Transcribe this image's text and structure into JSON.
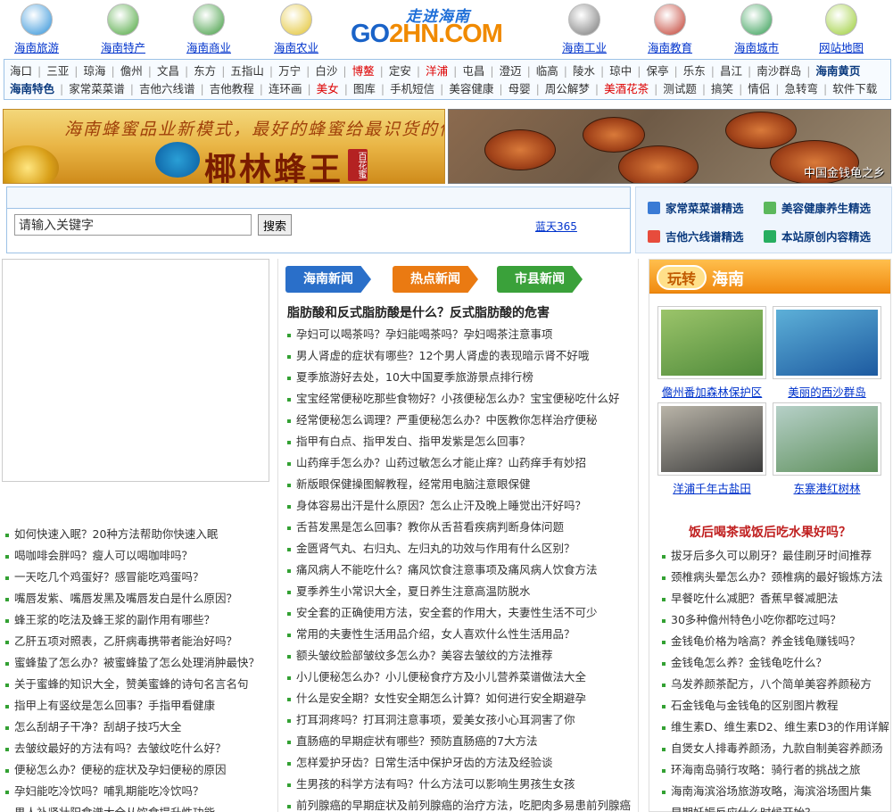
{
  "top_nav": [
    {
      "label": "海南旅游",
      "icon": "beach-icon",
      "color": "#2a8fd8"
    },
    {
      "label": "海南特产",
      "icon": "fruit-icon",
      "color": "#4aa53a"
    },
    {
      "label": "海南商业",
      "icon": "money-bag-icon",
      "color": "#3c9a3c"
    },
    {
      "label": "海南农业",
      "icon": "plant-icon",
      "color": "#e2c22a"
    },
    {
      "label": "海南工业",
      "icon": "factory-icon",
      "color": "#777777"
    },
    {
      "label": "海南教育",
      "icon": "books-icon",
      "color": "#c0392b"
    },
    {
      "label": "海南城市",
      "icon": "city-icon",
      "color": "#2e9b4f"
    },
    {
      "label": "网站地图",
      "icon": "map-icon",
      "color": "#9acd32"
    }
  ],
  "logo": {
    "subtitle": "走进海南",
    "name_a": "GO",
    "name_b": "2HN.COM"
  },
  "cities_row1": [
    {
      "t": "海口"
    },
    {
      "t": "三亚"
    },
    {
      "t": "琼海"
    },
    {
      "t": "儋州"
    },
    {
      "t": "文昌"
    },
    {
      "t": "东方"
    },
    {
      "t": "五指山"
    },
    {
      "t": "万宁"
    },
    {
      "t": "白沙"
    },
    {
      "t": "博鳌",
      "red": true
    },
    {
      "t": "定安"
    },
    {
      "t": "洋浦",
      "red": true
    },
    {
      "t": "屯昌"
    },
    {
      "t": "澄迈"
    },
    {
      "t": "临高"
    },
    {
      "t": "陵水"
    },
    {
      "t": "琼中"
    },
    {
      "t": "保亭"
    },
    {
      "t": "乐东"
    },
    {
      "t": "昌江"
    },
    {
      "t": "南沙群岛"
    },
    {
      "t": "海南黄页",
      "bold": true
    }
  ],
  "cities_row2": [
    {
      "t": "海南特色",
      "bold": true
    },
    {
      "t": "家常菜菜谱"
    },
    {
      "t": "吉他六线谱"
    },
    {
      "t": "吉他教程"
    },
    {
      "t": "连环画"
    },
    {
      "t": "美女",
      "red": true
    },
    {
      "t": "图库"
    },
    {
      "t": "手机短信"
    },
    {
      "t": "美容健康"
    },
    {
      "t": "母婴"
    },
    {
      "t": "周公解梦"
    },
    {
      "t": "美酒花茶",
      "red": true
    },
    {
      "t": "测试题"
    },
    {
      "t": "搞笑"
    },
    {
      "t": "情侣"
    },
    {
      "t": "急转弯"
    },
    {
      "t": "软件下载"
    }
  ],
  "banner_left": {
    "slogan": "海南蜂蜜品业新模式，最好的蜂蜜给最识货的你",
    "brand": "椰林蜂王",
    "seal": "百花蜜"
  },
  "banner_right": {
    "caption": "中国金钱龟之乡"
  },
  "search": {
    "placeholder": "请输入关键字",
    "button": "搜索",
    "link": "蓝天365"
  },
  "quick_links": [
    {
      "label": "家常菜菜谱精选",
      "icon": "book-icon",
      "color": "#3a7bd5"
    },
    {
      "label": "美容健康养生精选",
      "icon": "calendar-icon",
      "color": "#5cb85c"
    },
    {
      "label": "吉他六线谱精选",
      "icon": "music-icon",
      "color": "#e74c3c"
    },
    {
      "label": "本站原创内容精选",
      "icon": "grid-icon",
      "color": "#27ae60"
    }
  ],
  "left_list": [
    "如何快速入眠？20种方法帮助你快速入眠",
    "喝咖啡会胖吗？瘦人可以喝咖啡吗？",
    "一天吃几个鸡蛋好？感冒能吃鸡蛋吗？",
    "嘴唇发紫、嘴唇发黑及嘴唇发白是什么原因？",
    "蜂王浆的吃法及蜂王浆的副作用有哪些？",
    "乙肝五项对照表，乙肝病毒携带者能治好吗？",
    "蜜蜂蛰了怎么办？被蜜蜂蛰了怎么处理消肿最快？",
    "关于蜜蜂的知识大全，赞美蜜蜂的诗句名言名句",
    "指甲上有竖纹是怎么回事？手指甲看健康",
    "怎么刮胡子干净？刮胡子技巧大全",
    "去皱纹最好的方法有吗？去皱纹吃什么好？",
    "便秘怎么办？便秘的症状及孕妇便秘的原因",
    "孕妇能吃冷饮吗？哺乳期能吃冷饮吗？",
    "男人补肾壮阳食谱大全从饮食提升性功能"
  ],
  "mid_tabs": [
    {
      "label": "海南新闻",
      "color": "#2a6fc9"
    },
    {
      "label": "热点新闻",
      "color": "#ea7a12"
    },
    {
      "label": "市县新闻",
      "color": "#3aa13a"
    }
  ],
  "headline": "脂肪酸和反式脂肪酸是什么？反式脂肪酸的危害",
  "mid_list": [
    "孕妇可以喝茶吗？孕妇能喝茶吗？孕妇喝茶注意事项",
    "男人肾虚的症状有哪些？12个男人肾虚的表现暗示肾不好哦",
    "夏季旅游好去处，10大中国夏季旅游景点排行榜",
    "宝宝经常便秘吃那些食物好？小孩便秘怎么办？宝宝便秘吃什么好",
    "经常便秘怎么调理？严重便秘怎么办？中医教你怎样治疗便秘",
    "指甲有白点、指甲发白、指甲发紫是怎么回事？",
    "山药痒手怎么办？山药过敏怎么才能止痒？山药痒手有妙招",
    "新版眼保健操图解教程，经常用电脑注意眼保健",
    "身体容易出汗是什么原因？怎么止汗及晚上睡觉出汗好吗？",
    "舌苔发黑是怎么回事？教你从舌苔看疾病判断身体问题",
    "金匮肾气丸、右归丸、左归丸的功效与作用有什么区别？",
    "痛风病人不能吃什么？痛风饮食注意事项及痛风病人饮食方法",
    "夏季养生小常识大全，夏日养生注意高温防脱水",
    "安全套的正确使用方法，安全套的作用大，夫妻性生活不可少",
    "常用的夫妻性生活用品介绍，女人喜欢什么性生活用品？",
    "额头皱纹脸部皱纹多怎么办？美容去皱纹的方法推荐",
    "小儿便秘怎么办？小儿便秘食疗方及小儿营养菜谱做法大全",
    "什么是安全期？女性安全期怎么计算？如何进行安全期避孕",
    "打耳洞疼吗？打耳洞注意事项，爱美女孩小心耳洞害了你",
    "直肠癌的早期症状有哪些？预防直肠癌的7大方法",
    "怎样爱护牙齿？日常生活中保护牙齿的方法及经验谈",
    "生男孩的科学方法有吗？什么方法可以影响生男孩生女孩",
    "前列腺癌的早期症状及前列腺癌的治疗方法，吃肥肉多易患前列腺癌"
  ],
  "right_header": {
    "a": "玩转",
    "b": "海南"
  },
  "right_pics": [
    {
      "caption": "儋州番加森林保护区",
      "c1": "#4f8a3a",
      "c2": "#9bc46a"
    },
    {
      "caption": "美丽的西沙群岛",
      "c1": "#1d5aa0",
      "c2": "#5db0d8"
    },
    {
      "caption": "洋浦千年古盐田",
      "c1": "#3b3b3b",
      "c2": "#b9b4a8"
    },
    {
      "caption": "东寨港红树林",
      "c1": "#5d8f5a",
      "c2": "#b6d0c8"
    }
  ],
  "right_title": "饭后喝茶或饭后吃水果好吗？",
  "right_list": [
    "拔牙后多久可以刷牙？最佳刷牙时间推荐",
    "颈椎病头晕怎么办？颈椎病的最好锻炼方法",
    "早餐吃什么减肥？香蕉早餐减肥法",
    "30多种儋州特色小吃你都吃过吗？",
    "金钱龟价格为啥高？养金钱龟赚钱吗？",
    "金钱龟怎么养？金钱龟吃什么？",
    "乌发养颜茶配方，八个简单美容养颜秘方",
    "石金钱龟与金钱龟的区别图片教程",
    "维生素D、维生素D2、维生素D3的作用详解",
    "自煲女人排毒养颜汤，九款自制美容养颜汤",
    "环海南岛骑行攻略：骑行者的挑战之旅",
    "海南海滨浴场旅游攻略，海滨浴场图片集",
    "早期妊娠反应什么时候开始？"
  ]
}
